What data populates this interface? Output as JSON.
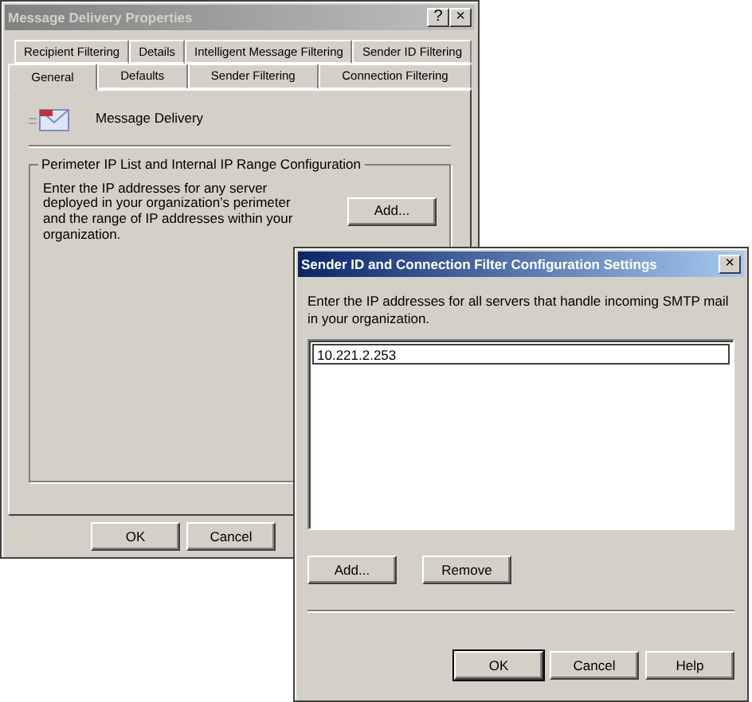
{
  "properties_window": {
    "title": "Message Delivery Properties",
    "active": false,
    "help_glyph": "?",
    "close_glyph": "×",
    "tab_rows": [
      {
        "tabs": [
          {
            "label": "Recipient Filtering",
            "selected": false
          },
          {
            "label": "Details",
            "selected": false
          },
          {
            "label": "Intelligent Message Filtering",
            "selected": false
          },
          {
            "label": "Sender ID Filtering",
            "selected": false
          }
        ]
      },
      {
        "tabs": [
          {
            "label": "General",
            "selected": true
          },
          {
            "label": "Defaults",
            "selected": false
          },
          {
            "label": "Sender Filtering",
            "selected": false
          },
          {
            "label": "Connection Filtering",
            "selected": false
          }
        ]
      }
    ],
    "heading": "Message Delivery",
    "group": {
      "title": "Perimeter IP List and Internal IP Range Configuration",
      "description": "Enter the IP addresses for any server deployed in your organization’s perimeter and the range of IP addresses within your organization.",
      "button": "Add..."
    },
    "buttons": [
      {
        "label": "OK",
        "default": false
      },
      {
        "label": "Cancel",
        "default": false
      }
    ]
  },
  "settings_dialog": {
    "title": "Sender ID and Connection Filter Configuration Settings",
    "active": true,
    "close_glyph": "×",
    "description": "Enter the IP addresses for all servers that handle incoming SMTP mail in your organization.",
    "entries": [
      "10.221.2.253"
    ],
    "list_buttons": [
      "Add...",
      "Remove"
    ],
    "buttons": [
      {
        "label": "OK",
        "default": true
      },
      {
        "label": "Cancel",
        "default": false
      },
      {
        "label": "Help",
        "default": false
      }
    ]
  }
}
